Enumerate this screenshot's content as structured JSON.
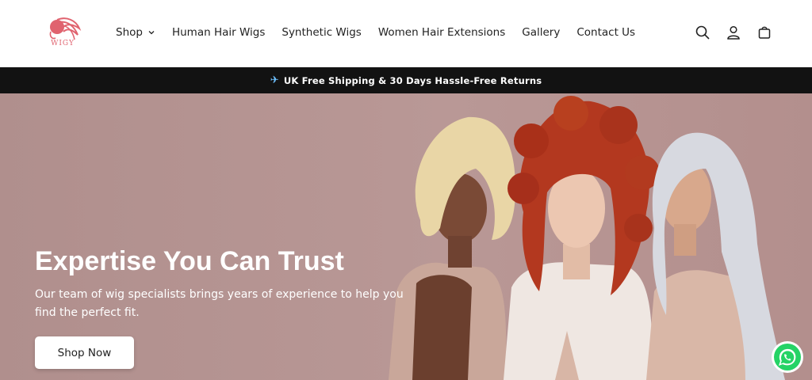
{
  "header": {
    "logo_text": "WIGY",
    "nav": [
      {
        "label": "Shop",
        "has_dropdown": true
      },
      {
        "label": "Human Hair Wigs"
      },
      {
        "label": "Synthetic Wigs"
      },
      {
        "label": "Women Hair Extensions"
      },
      {
        "label": "Gallery"
      },
      {
        "label": "Contact Us"
      }
    ],
    "icons": [
      "search-icon",
      "account-icon",
      "cart-icon"
    ]
  },
  "announcement": {
    "icon": "airplane-icon",
    "text": "UK Free Shipping & 30 Days Hassle-Free Returns"
  },
  "hero": {
    "title": "Expertise You Can Trust",
    "subtitle": "Our team of wig specialists brings years of experience to help you find the perfect fit.",
    "button_label": "Shop Now"
  },
  "floating": {
    "icon": "whatsapp-icon"
  },
  "colors": {
    "brand": "#e0636f",
    "announcement_bg": "#121212",
    "hero_bg": "#b49492",
    "text": "#222222"
  }
}
